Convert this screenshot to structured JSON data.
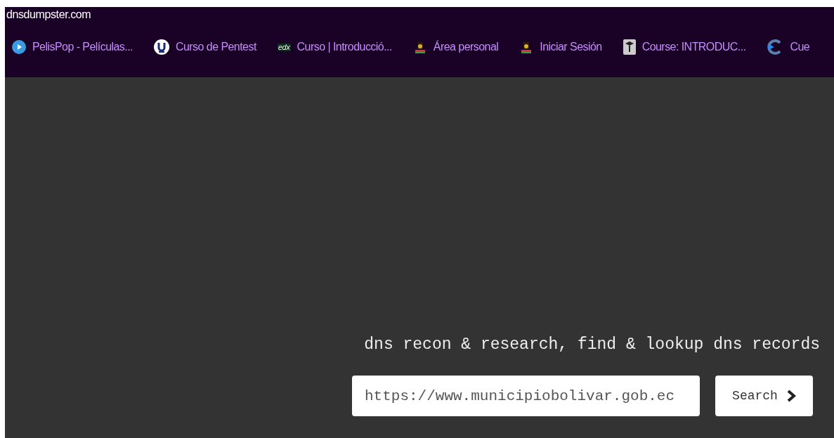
{
  "window": {
    "title": "dnsdumpster.com"
  },
  "bookmarks": [
    {
      "kind": "play",
      "label": "PelisPop - Películas..."
    },
    {
      "kind": "u-circle",
      "label": "Curso de Pentest"
    },
    {
      "kind": "edx",
      "icon_text": "edx",
      "label": "Curso | Introducció..."
    },
    {
      "kind": "crest",
      "label": "Área personal"
    },
    {
      "kind": "crest",
      "label": "Iniciar Sesión"
    },
    {
      "kind": "grad",
      "label": "Course: INTRODUC..."
    },
    {
      "kind": "c-logo",
      "label": "Cue"
    }
  ],
  "tagline": "dns recon & research, find & lookup dns records",
  "search": {
    "value": "https://www.municipiobolivar.gob.ec",
    "button": "Search"
  }
}
